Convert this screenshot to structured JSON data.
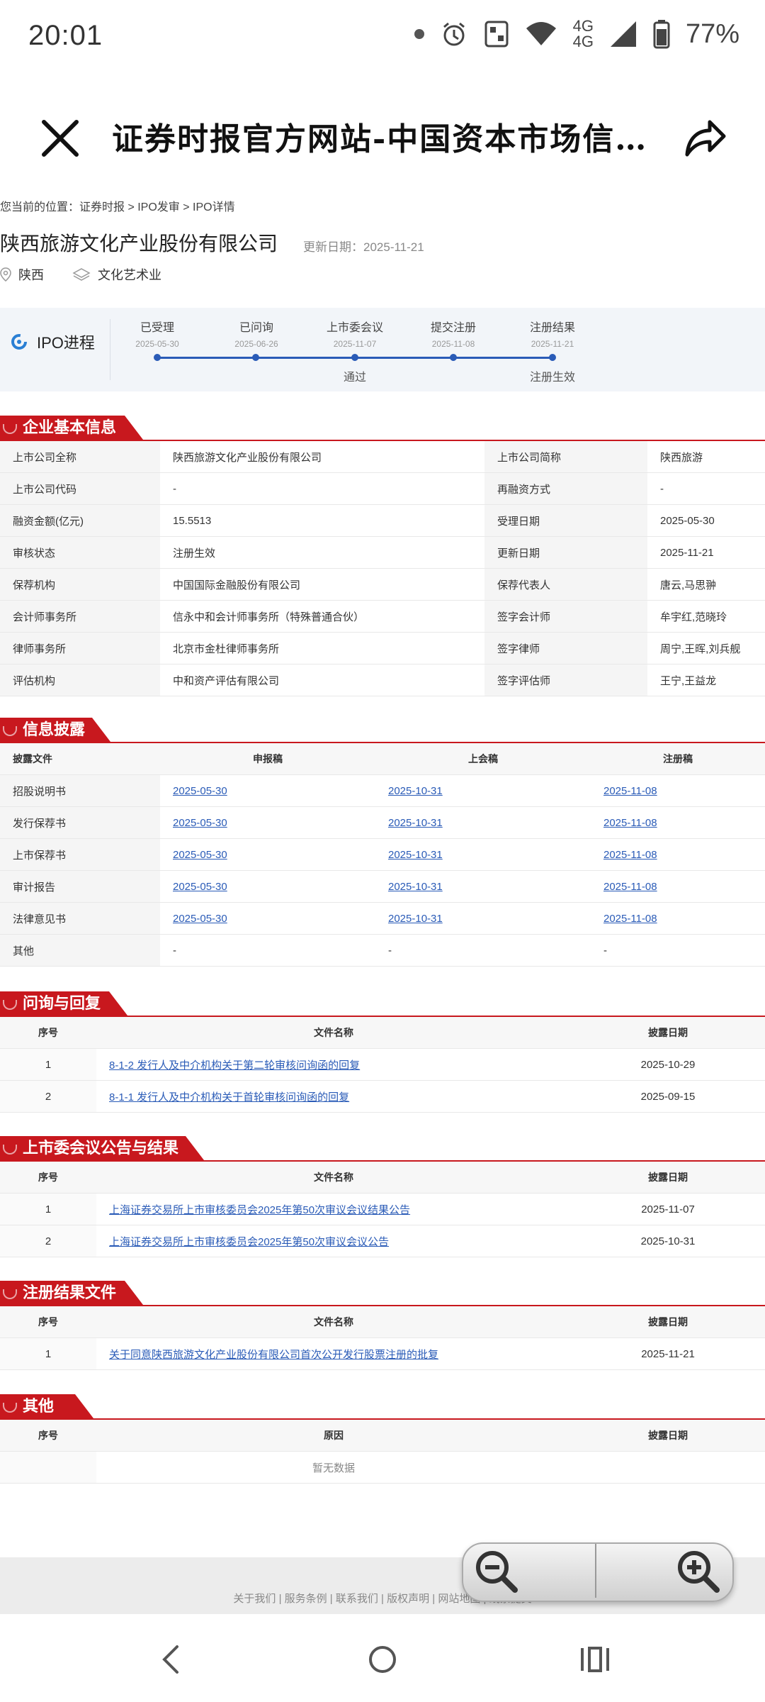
{
  "status": {
    "time": "20:01",
    "network": "4G",
    "network2": "4G",
    "battery": "77%"
  },
  "browser": {
    "title": "证券时报官方网站-中国资本市场信…"
  },
  "breadcrumb": "您当前的位置：证券时报 > IPO发审 > IPO详情",
  "company": {
    "name": "陕西旅游文化产业股份有限公司",
    "update": "更新日期：2025-11-21",
    "region": "陕西",
    "industry": "文化艺术业"
  },
  "ipo": {
    "label": "IPO进程",
    "stages": [
      {
        "name": "已受理",
        "date": "2025-05-30",
        "note": ""
      },
      {
        "name": "已问询",
        "date": "2025-06-26",
        "note": ""
      },
      {
        "name": "上市委会议",
        "date": "2025-11-07",
        "note": "通过"
      },
      {
        "name": "提交注册",
        "date": "2025-11-08",
        "note": ""
      },
      {
        "name": "注册结果",
        "date": "2025-11-21",
        "note": "注册生效"
      }
    ]
  },
  "basic": {
    "title": "企业基本信息",
    "rows": [
      [
        "上市公司全称",
        "陕西旅游文化产业股份有限公司",
        "上市公司简称",
        "陕西旅游"
      ],
      [
        "上市公司代码",
        "-",
        "再融资方式",
        "-"
      ],
      [
        "融资金额(亿元)",
        "15.5513",
        "受理日期",
        "2025-05-30"
      ],
      [
        "审核状态",
        "注册生效",
        "更新日期",
        "2025-11-21"
      ],
      [
        "保荐机构",
        "中国国际金融股份有限公司",
        "保荐代表人",
        "唐云,马思翀"
      ],
      [
        "会计师事务所",
        "信永中和会计师事务所（特殊普通合伙）",
        "签字会计师",
        "牟宇红,范晓玲"
      ],
      [
        "律师事务所",
        "北京市金杜律师事务所",
        "签字律师",
        "周宁,王晖,刘兵舰"
      ],
      [
        "评估机构",
        "中和资产评估有限公司",
        "签字评估师",
        "王宁,王益龙"
      ]
    ]
  },
  "disclosure": {
    "title": "信息披露",
    "headers": [
      "披露文件",
      "申报稿",
      "上会稿",
      "注册稿"
    ],
    "rows": [
      [
        "招股说明书",
        "2025-05-30",
        "2025-10-31",
        "2025-11-08"
      ],
      [
        "发行保荐书",
        "2025-05-30",
        "2025-10-31",
        "2025-11-08"
      ],
      [
        "上市保荐书",
        "2025-05-30",
        "2025-10-31",
        "2025-11-08"
      ],
      [
        "审计报告",
        "2025-05-30",
        "2025-10-31",
        "2025-11-08"
      ],
      [
        "法律意见书",
        "2025-05-30",
        "2025-10-31",
        "2025-11-08"
      ],
      [
        "其他",
        "-",
        "-",
        "-"
      ]
    ]
  },
  "inquiry": {
    "title": "问询与回复",
    "headers": [
      "序号",
      "文件名称",
      "披露日期"
    ],
    "rows": [
      [
        "1",
        "8-1-2 发行人及中介机构关于第二轮审核问询函的回复",
        "2025-10-29"
      ],
      [
        "2",
        "8-1-1 发行人及中介机构关于首轮审核问询函的回复",
        "2025-09-15"
      ]
    ]
  },
  "meeting": {
    "title": "上市委会议公告与结果",
    "headers": [
      "序号",
      "文件名称",
      "披露日期"
    ],
    "rows": [
      [
        "1",
        "上海证券交易所上市审核委员会2025年第50次审议会议结果公告",
        "2025-11-07"
      ],
      [
        "2",
        "上海证券交易所上市审核委员会2025年第50次审议会议公告",
        "2025-10-31"
      ]
    ]
  },
  "registration": {
    "title": "注册结果文件",
    "headers": [
      "序号",
      "文件名称",
      "披露日期"
    ],
    "rows": [
      [
        "1",
        "关于同意陕西旅游文化产业股份有限公司首次公开发行股票注册的批复",
        "2025-11-21"
      ]
    ]
  },
  "other": {
    "title": "其他",
    "headers": [
      "序号",
      "原因",
      "披露日期"
    ],
    "empty": "暂无数据"
  },
  "footer": {
    "links": "关于我们 | 服务条例 | 联系我们 | 版权声明 | 网站地图 | 线索提交"
  }
}
